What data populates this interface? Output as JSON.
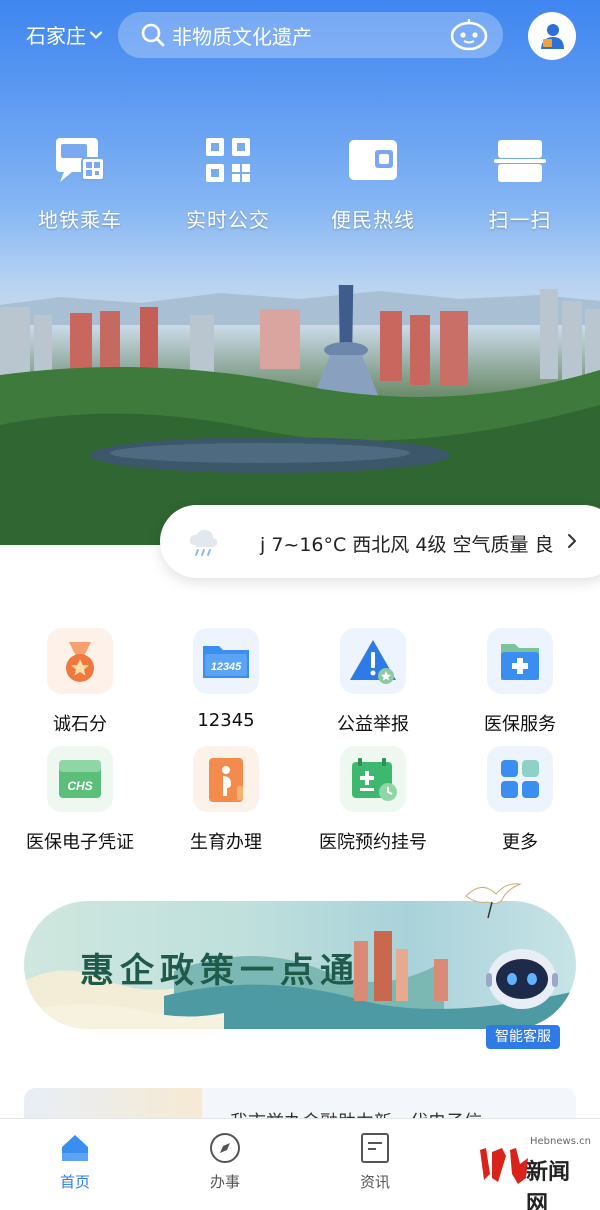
{
  "header": {
    "city": "石家庄",
    "search_placeholder": "非物质文化遗产"
  },
  "quick_actions": [
    {
      "label": "地铁乘车",
      "icon": "metro-card-icon"
    },
    {
      "label": "实时公交",
      "icon": "qr-code-icon"
    },
    {
      "label": "便民热线",
      "icon": "wallet-icon"
    },
    {
      "label": "扫一扫",
      "icon": "scan-icon"
    }
  ],
  "weather": {
    "text": "j 7~16°C 西北风 4级 空气质量 良",
    "icon": "rain-cloud-icon"
  },
  "services": [
    {
      "label": "诚石分",
      "icon": "medal-icon",
      "color": "#f1773f"
    },
    {
      "label": "12345",
      "icon": "folder-12345-icon",
      "color": "#3a8ef0"
    },
    {
      "label": "公益举报",
      "icon": "warning-icon",
      "color": "#2f7be6"
    },
    {
      "label": "医保服务",
      "icon": "medical-folder-icon",
      "color": "#3a8ef0"
    },
    {
      "label": "医保电子凭证",
      "icon": "chs-card-icon",
      "color": "#5bbf7a"
    },
    {
      "label": "生育办理",
      "icon": "maternity-icon",
      "color": "#f28b4b"
    },
    {
      "label": "医院预约挂号",
      "icon": "calendar-medical-icon",
      "color": "#3fb86f"
    },
    {
      "label": "更多",
      "icon": "grid-more-icon",
      "color": "#3a8ef0"
    }
  ],
  "banner": {
    "title": "惠企政策一点通",
    "badge": "智能客服"
  },
  "news": {
    "text": "我市举办金融助力新一代电子信"
  },
  "tabs": [
    {
      "label": "首页",
      "icon": "home-icon",
      "active": true
    },
    {
      "label": "办事",
      "icon": "compass-icon",
      "active": false
    },
    {
      "label": "资讯",
      "icon": "document-icon",
      "active": false
    }
  ],
  "watermark": {
    "site": "Hebnews.cn",
    "name": "新闻网"
  }
}
